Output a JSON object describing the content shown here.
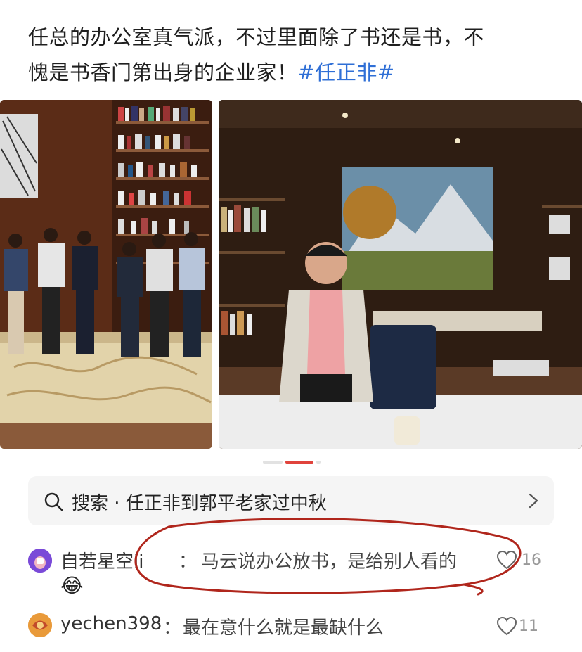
{
  "post": {
    "line1": "任总的办公室真气派，不过里面除了书还是书，不",
    "line2": "愧是书香门第出身的企业家！",
    "hashtag": "#任正非#"
  },
  "search": {
    "label": "搜索 · 任正非到郭平老家过中秋"
  },
  "comments": [
    {
      "user": "自若星空ii",
      "separator": "：",
      "text": "马云说办公放书，是给别人看的",
      "emoji": "😂",
      "likes": "16"
    },
    {
      "user": "yechen398",
      "separator": "：",
      "text": "最在意什么就是最缺什么",
      "likes": "11"
    }
  ],
  "colors": {
    "hashtag": "#2f6fd6",
    "pager_active": "#e0433c",
    "annotation": "#b0261c"
  }
}
